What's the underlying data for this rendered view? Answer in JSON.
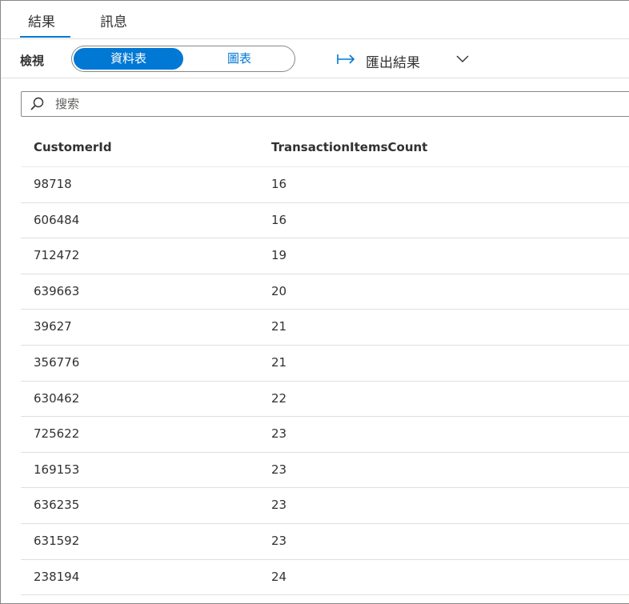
{
  "tabs": [
    {
      "label": "結果",
      "active": true
    },
    {
      "label": "訊息",
      "active": false
    }
  ],
  "toolbar": {
    "view_label": "檢視",
    "view_options": [
      {
        "label": "資料表",
        "selected": true
      },
      {
        "label": "圖表",
        "selected": false
      }
    ],
    "export_label": "匯出結果",
    "export_icon": "export-arrow-icon",
    "dropdown_icon": "chevron-down-icon"
  },
  "search": {
    "placeholder": "搜索",
    "value": "",
    "icon": "search-icon"
  },
  "table": {
    "columns": [
      "CustomerId",
      "TransactionItemsCount"
    ],
    "rows": [
      [
        "98718",
        "16"
      ],
      [
        "606484",
        "16"
      ],
      [
        "712472",
        "19"
      ],
      [
        "639663",
        "20"
      ],
      [
        "39627",
        "21"
      ],
      [
        "356776",
        "21"
      ],
      [
        "630462",
        "22"
      ],
      [
        "725622",
        "23"
      ],
      [
        "169153",
        "23"
      ],
      [
        "636235",
        "23"
      ],
      [
        "631592",
        "23"
      ],
      [
        "238194",
        "24"
      ]
    ]
  },
  "colors": {
    "accent": "#0078d4",
    "text": "#323130",
    "border": "#8a8886",
    "divider": "#e1dfdd"
  }
}
